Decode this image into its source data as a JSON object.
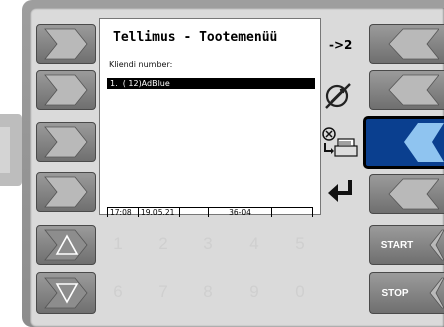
{
  "screen": {
    "title": "Tellimus - Tootemenüü",
    "customer_label": "Kliendi number:",
    "items": [
      "1.  ( 12)AdBlue"
    ],
    "status": {
      "time": "17:08",
      "date": "19.05.21",
      "blank": "",
      "code": "36-04",
      "extra": ""
    }
  },
  "softkeys": {
    "page_indicator": "->2"
  },
  "keypad": {
    "keys": [
      "1",
      "2",
      "3",
      "4",
      "5",
      "6",
      "7",
      "8",
      "9",
      "0"
    ],
    "start_label": "START",
    "stop_label": "STOP"
  },
  "colors": {
    "selected_button": "#0a3f8f",
    "screen_bg": "#ffffff",
    "button_bg": "#7f7f7f"
  }
}
